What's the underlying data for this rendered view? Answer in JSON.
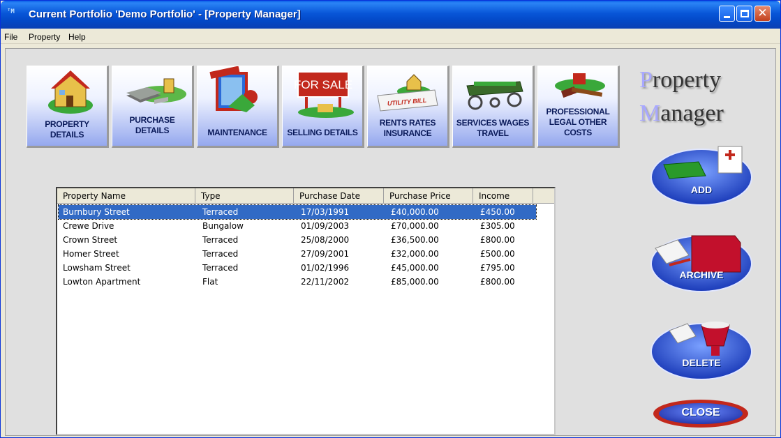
{
  "window": {
    "title": "Current Portfolio 'Demo Portfolio' - [Property Manager]",
    "app_icon_text": "ᵀM"
  },
  "menu": [
    "File",
    "Property",
    "Help"
  ],
  "nav_buttons": [
    {
      "label": "PROPERTY DETAILS",
      "icon": "house-icon"
    },
    {
      "label": "PURCHASE DETAILS",
      "icon": "money-house-icon"
    },
    {
      "label": "MAINTENANCE",
      "icon": "paint-window-icon"
    },
    {
      "label": "SELLING DETAILS",
      "icon": "for-sale-sign-icon"
    },
    {
      "label": "RENTS RATES INSURANCE",
      "icon": "utility-bill-icon"
    },
    {
      "label": "SERVICES WAGES TRAVEL",
      "icon": "cart-icon"
    },
    {
      "label": "PROFESSIONAL LEGAL OTHER COSTS",
      "icon": "gavel-icon"
    }
  ],
  "for_sale_text": "FOR SALE",
  "utility_bill_text": "UTILITY BILL",
  "brand": {
    "line1_initial": "P",
    "line1_rest": "roperty",
    "line2_initial": "M",
    "line2_rest": "anager"
  },
  "table": {
    "columns": [
      "Property Name",
      "Type",
      "Purchase Date",
      "Purchase Price",
      "Income"
    ],
    "rows": [
      [
        "Burnbury Street",
        "Terraced",
        "17/03/1991",
        "£40,000.00",
        "£450.00"
      ],
      [
        "Crewe Drive",
        "Bungalow",
        "01/09/2003",
        "£70,000.00",
        "£305.00"
      ],
      [
        "Crown Street",
        "Terraced",
        "25/08/2000",
        "£36,500.00",
        "£800.00"
      ],
      [
        "Homer Street",
        "Terraced",
        "27/09/2001",
        "£32,000.00",
        "£500.00"
      ],
      [
        "Lowsham Street",
        "Terraced",
        "01/02/1996",
        "£45,000.00",
        "£795.00"
      ],
      [
        "Lowton Apartment",
        "Flat",
        "22/11/2002",
        "£85,000.00",
        "£800.00"
      ]
    ],
    "selected_row": 0
  },
  "side_buttons": {
    "add": "ADD",
    "archive": "ARCHIVE",
    "delete": "DELETE",
    "close": "CLOSE"
  },
  "colors": {
    "title_bar": "#0856d8",
    "selection": "#316ac5",
    "nav_gradient_bottom": "#95a8ee",
    "close_red": "#c2401d"
  }
}
